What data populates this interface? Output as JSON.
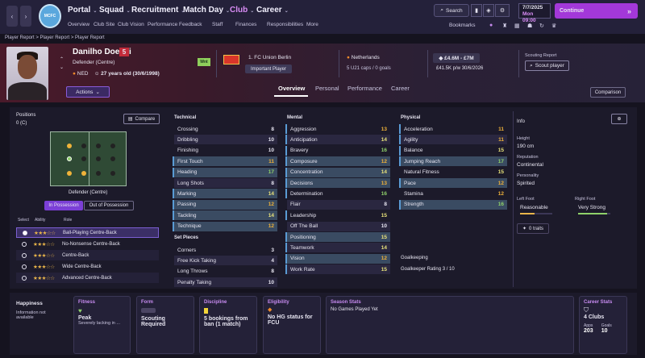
{
  "topbar": {
    "nav": [
      {
        "label": "Portal"
      },
      {
        "label": "Squad"
      },
      {
        "label": "Recruitment"
      },
      {
        "label": "Match Day"
      },
      {
        "label": "Club"
      },
      {
        "label": "Career"
      }
    ],
    "subnav": [
      "Overview",
      "Club Site",
      "Club Vision",
      "Performance Feedback",
      "Staff",
      "Finances",
      "Responsibilities",
      "More"
    ],
    "search_label": "Search",
    "date_line1": "7/7/2025",
    "date_line2": "Mon  09:00",
    "continue_label": "Continue",
    "bookmarks_label": "Bookmarks",
    "accent": "#a338d9"
  },
  "breadcrumb": "Player Report  >  Player Report  >  Player Report",
  "player": {
    "name": "Danilho Doekhi",
    "number": "5",
    "position": "Defender (Centre)",
    "nationality_code": "NED",
    "age_line": "27 years old (30/6/1998)",
    "wanted_badge": "Wnt",
    "club": "1. FC Union Berlin",
    "club_status": "Important Player",
    "nation": "Netherlands",
    "caps": "5 U21 caps / 0 goals",
    "value": "£4.6M - £7M",
    "wage": "£41.5K p/w  30/6/2026",
    "actions_label": "Actions"
  },
  "scouting": {
    "label": "Scouting Report",
    "button": "Scout player"
  },
  "tabs": [
    "Overview",
    "Personal",
    "Performance",
    "Career"
  ],
  "comparison_label": "Comparison",
  "positions": {
    "title": "Positions",
    "count": "0 (C)",
    "compare_label": "Compare",
    "role_caption": "Defender (Centre)",
    "in_possession": "In Possession",
    "out_possession": "Out of Possession",
    "headers": [
      "Select",
      "Ability",
      "Role"
    ],
    "roles": [
      {
        "name": "Ball-Playing Centre-Back",
        "stars": "★★★☆☆"
      },
      {
        "name": "No-Nonsense Centre-Back",
        "stars": "★★★☆☆"
      },
      {
        "name": "Centre-Back",
        "stars": "★★★☆☆"
      },
      {
        "name": "Wide Centre-Back",
        "stars": "★★★☆☆"
      },
      {
        "name": "Advanced Centre-Back",
        "stars": "★★★☆☆"
      }
    ]
  },
  "technical": {
    "title": "Technical",
    "items": [
      {
        "n": "Crossing",
        "v": "8"
      },
      {
        "n": "Dribbling",
        "v": "10"
      },
      {
        "n": "Finishing",
        "v": "10"
      },
      {
        "n": "First Touch",
        "v": "11"
      },
      {
        "n": "Heading",
        "v": "17"
      },
      {
        "n": "Long Shots",
        "v": "8"
      },
      {
        "n": "Marking",
        "v": "14"
      },
      {
        "n": "Passing",
        "v": "12"
      },
      {
        "n": "Tackling",
        "v": "14"
      },
      {
        "n": "Technique",
        "v": "12"
      }
    ]
  },
  "set_pieces": {
    "title": "Set Pieces",
    "items": [
      {
        "n": "Corners",
        "v": "3"
      },
      {
        "n": "Free Kick Taking",
        "v": "4"
      },
      {
        "n": "Long Throws",
        "v": "8"
      },
      {
        "n": "Penalty Taking",
        "v": "10"
      }
    ]
  },
  "mental": {
    "title": "Mental",
    "items": [
      {
        "n": "Aggression",
        "v": "13"
      },
      {
        "n": "Anticipation",
        "v": "14"
      },
      {
        "n": "Bravery",
        "v": "16"
      },
      {
        "n": "Composure",
        "v": "12"
      },
      {
        "n": "Concentration",
        "v": "14"
      },
      {
        "n": "Decisions",
        "v": "13"
      },
      {
        "n": "Determination",
        "v": "16"
      },
      {
        "n": "Flair",
        "v": "8"
      },
      {
        "n": "Leadership",
        "v": "15"
      },
      {
        "n": "Off The Ball",
        "v": "10"
      },
      {
        "n": "Positioning",
        "v": "15"
      },
      {
        "n": "Teamwork",
        "v": "14"
      },
      {
        "n": "Vision",
        "v": "12"
      },
      {
        "n": "Work Rate",
        "v": "15"
      }
    ]
  },
  "physical": {
    "title": "Physical",
    "items": [
      {
        "n": "Acceleration",
        "v": "11"
      },
      {
        "n": "Agility",
        "v": "11"
      },
      {
        "n": "Balance",
        "v": "15"
      },
      {
        "n": "Jumping Reach",
        "v": "17"
      },
      {
        "n": "Natural Fitness",
        "v": "15"
      },
      {
        "n": "Pace",
        "v": "12"
      },
      {
        "n": "Stamina",
        "v": "12"
      },
      {
        "n": "Strength",
        "v": "16"
      }
    ]
  },
  "goalkeeping": {
    "title": "Goalkeeping",
    "rating": "Goalkeeper Rating  3 / 10"
  },
  "info": {
    "title": "Info",
    "height_label": "Height",
    "height": "190 cm",
    "reputation_label": "Reputation",
    "reputation": "Continental",
    "personality_label": "Personality",
    "personality": "Spirited",
    "left_foot_label": "Left Foot",
    "left_foot": "Reasonable",
    "left_foot_level": 0.45,
    "right_foot_label": "Right Foot",
    "right_foot": "Very Strong",
    "right_foot_level": 0.9,
    "traits": "0 traits"
  },
  "bottom": {
    "happiness_title": "Happiness",
    "happiness_text": "Information not available",
    "fitness_title": "Fitness",
    "fitness_value": "Peak",
    "fitness_sub": "Severely lacking in ...",
    "form_title": "Form",
    "form_value": "Scouting Required",
    "discipline_title": "Discipline",
    "discipline_value": "5 bookings from ban (1 match)",
    "eligibility_title": "Eligibility",
    "eligibility_value": "No HG status for FCU",
    "season_title": "Season Stats",
    "season_value": "No Games Played Yet",
    "career_title": "Career Stats",
    "career_value": "4 Clubs",
    "apps_label": "Apps",
    "apps": "203",
    "goals_label": "Goals",
    "goals": "10"
  }
}
